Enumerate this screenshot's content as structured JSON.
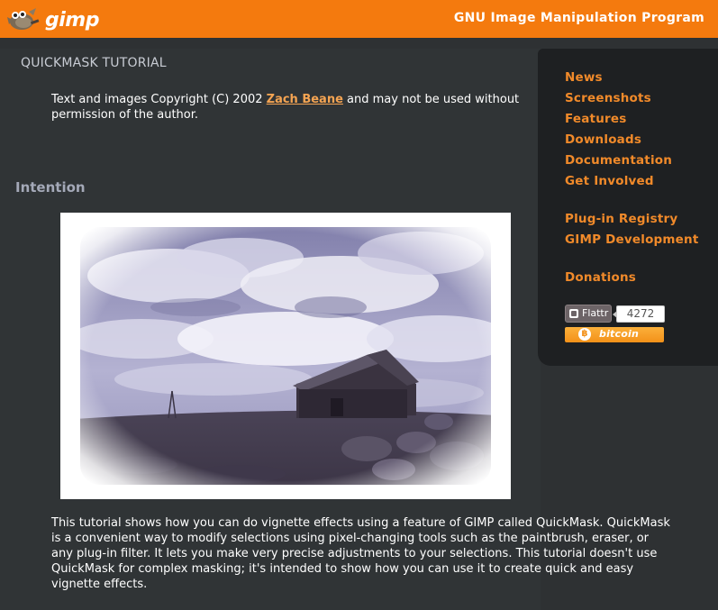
{
  "header": {
    "logo_text": "gimp",
    "site_title": "GNU Image Manipulation Program"
  },
  "content": {
    "page_title": "QUICKMASK TUTORIAL",
    "copyright_prefix": "Text and images Copyright (C) 2002 ",
    "copyright_author": "Zach Beane",
    "copyright_suffix": " and may not be used without permission of the author.",
    "section_heading": "Intention",
    "body_text": "This tutorial shows how you can do vignette effects using a feature of GIMP called QuickMask. QuickMask is a convenient way to modify selections using pixel-changing tools such as the paintbrush, eraser, or any plug-in filter. It lets you make very precise adjustments to your selections. This tutorial doesn't use QuickMask for complex masking; it's intended to show how you can use it to create quick and easy vignette effects."
  },
  "sidebar": {
    "nav": [
      {
        "label": "News"
      },
      {
        "label": "Screenshots"
      },
      {
        "label": "Features"
      },
      {
        "label": "Downloads"
      },
      {
        "label": "Documentation"
      },
      {
        "label": "Get Involved"
      },
      {
        "label": "Plug-in Registry"
      },
      {
        "label": "GIMP Development"
      },
      {
        "label": "Donations"
      }
    ],
    "flattr_label": "Flattr",
    "flattr_count": "4272",
    "bitcoin_label": "bitcoin"
  },
  "colors": {
    "header_orange": "#f47a0e",
    "link_orange": "#f18a2a",
    "background": "#2e3133",
    "sidebar_bg": "#1e2022"
  },
  "icons": {
    "logo": "gimp-wilber-icon",
    "flattr": "flattr-icon",
    "bitcoin": "bitcoin-icon"
  }
}
